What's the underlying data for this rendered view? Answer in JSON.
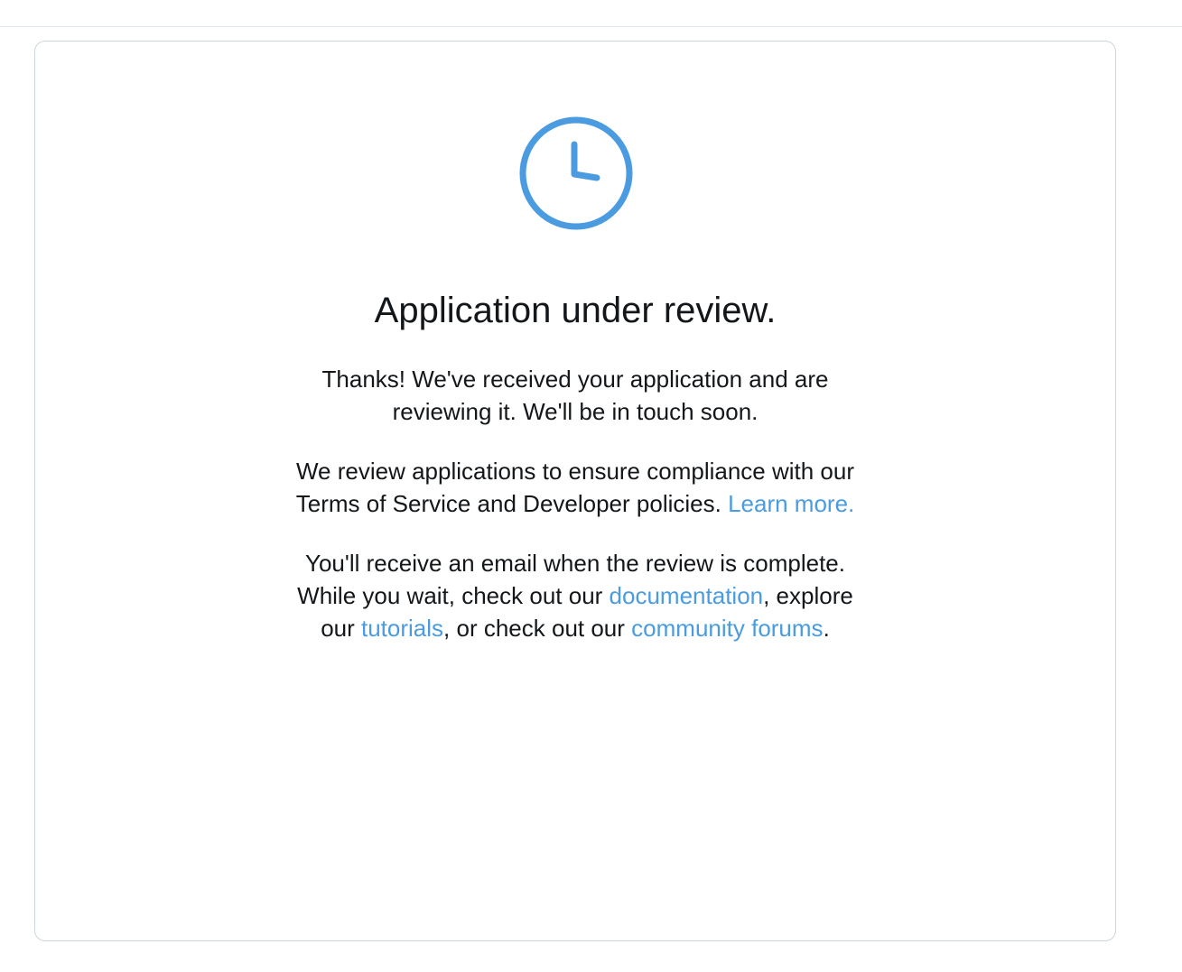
{
  "colors": {
    "accent": "#4a9be0",
    "text": "#14171a",
    "border": "#ccd6dd"
  },
  "icon": "clock-icon",
  "title": "Application under review.",
  "paragraph1": {
    "line1": "Thanks! We've received your application and are",
    "line2": "reviewing it. We'll be in touch soon."
  },
  "paragraph2": {
    "line1": "We review applications to ensure compliance with our",
    "line2_text": "Terms of Service and Developer policies.",
    "learn_more_link": "Learn more."
  },
  "paragraph3": {
    "line1": "You'll receive an email when the review is complete.",
    "line2_prefix": "While you wait, check out our",
    "documentation_link": "documentation",
    "line2_suffix": ", explore",
    "line3_prefix": "our",
    "tutorials_link": "tutorials",
    "line3_middle": ", or check out our",
    "community_forums_link": "community forums",
    "line3_suffix": "."
  }
}
